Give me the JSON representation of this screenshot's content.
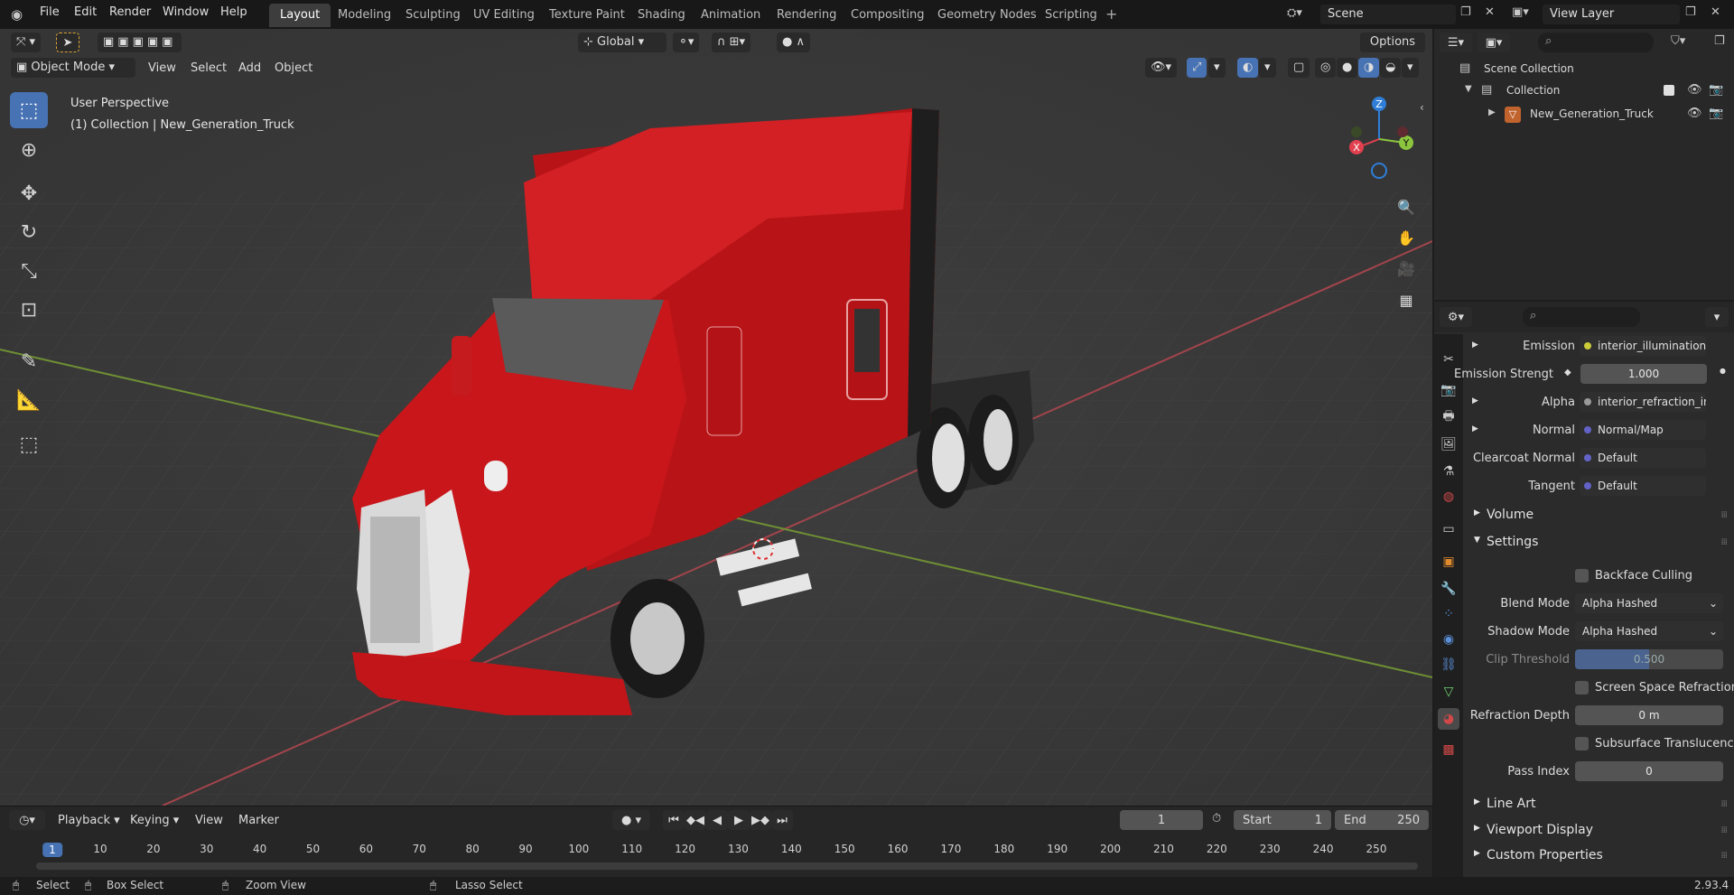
{
  "topbar": {
    "menus": [
      "File",
      "Edit",
      "Render",
      "Window",
      "Help"
    ],
    "workspaces": [
      "Layout",
      "Modeling",
      "Sculpting",
      "UV Editing",
      "Texture Paint",
      "Shading",
      "Animation",
      "Rendering",
      "Compositing",
      "Geometry Nodes",
      "Scripting"
    ],
    "add_tab": "+",
    "scene": "Scene",
    "view_layer": "View Layer"
  },
  "viewport": {
    "transform_orientation": "Global",
    "options_label": "Options",
    "mode": "Object Mode",
    "menus": [
      "View",
      "Select",
      "Add",
      "Object"
    ],
    "overlay_title": "User Perspective",
    "overlay_subtitle": "(1) Collection | New_Generation_Truck",
    "gizmo": {
      "z": "Z",
      "y": "Y",
      "x": "X"
    }
  },
  "outliner": {
    "root": "Scene Collection",
    "collection": "Collection",
    "object": "New_Generation_Truck"
  },
  "properties": {
    "rows": {
      "emission_label": "Emission",
      "emission_value": "interior_illumination...",
      "emission_strength_label": "Emission Strengt",
      "emission_strength_value": "1.000",
      "alpha_label": "Alpha",
      "alpha_value": "interior_refraction_in...",
      "normal_label": "Normal",
      "normal_value": "Normal/Map",
      "clearcoat_label": "Clearcoat Normal",
      "clearcoat_value": "Default",
      "tangent_label": "Tangent",
      "tangent_value": "Default"
    },
    "sections": {
      "volume": "Volume",
      "settings": "Settings",
      "line_art": "Line Art",
      "viewport_display": "Viewport Display",
      "custom_properties": "Custom Properties"
    },
    "settings": {
      "backface_culling": "Backface Culling",
      "blend_mode_label": "Blend Mode",
      "blend_mode_value": "Alpha Hashed",
      "shadow_mode_label": "Shadow Mode",
      "shadow_mode_value": "Alpha Hashed",
      "clip_threshold_label": "Clip Threshold",
      "clip_threshold_value": "0.500",
      "ssr_label": "Screen Space Refraction",
      "refraction_depth_label": "Refraction Depth",
      "refraction_depth_value": "0 m",
      "subsurface_label": "Subsurface Translucency",
      "pass_index_label": "Pass Index",
      "pass_index_value": "0"
    }
  },
  "timeline": {
    "menus": [
      "Playback",
      "Keying",
      "View",
      "Marker"
    ],
    "current_frame": "1",
    "start_label": "Start",
    "start_value": "1",
    "end_label": "End",
    "end_value": "250",
    "ticks": [
      "1",
      "10",
      "20",
      "30",
      "40",
      "50",
      "60",
      "70",
      "80",
      "90",
      "100",
      "110",
      "120",
      "130",
      "140",
      "150",
      "160",
      "170",
      "180",
      "190",
      "200",
      "210",
      "220",
      "230",
      "240",
      "250"
    ]
  },
  "statusbar": {
    "select": "Select",
    "box_select": "Box Select",
    "zoom_view": "Zoom View",
    "lasso_select": "Lasso Select",
    "version": "2.93.4"
  },
  "colors": {
    "accent": "#4772b3",
    "truck_red": "#c8161a",
    "x_axis": "#e2404f",
    "y_axis": "#8cc63f",
    "z_axis": "#2f7ed8"
  }
}
